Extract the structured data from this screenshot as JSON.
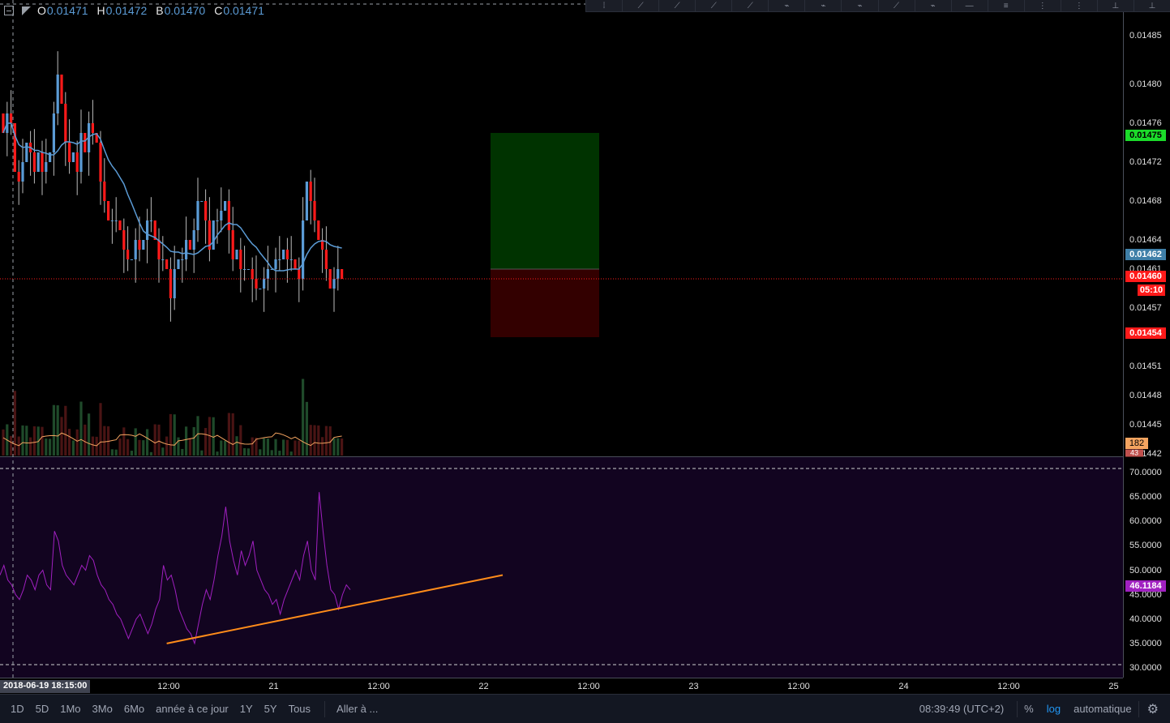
{
  "ohlc": {
    "o_label": "O",
    "o_value": "0.01471",
    "h_label": "H",
    "h_value": "0.01472",
    "b_label": "B",
    "b_value": "0.01470",
    "c_label": "C",
    "c_value": "0.01471"
  },
  "price_axis": {
    "labels": [
      "0.01485",
      "0.01480",
      "0.01476",
      "0.01472",
      "0.01468",
      "0.01464",
      "0.01461",
      "0.01457",
      "0.01451",
      "0.01448",
      "0.01445",
      "0.01442"
    ],
    "tags": {
      "take_profit": "0.01475",
      "ma": "0.01462",
      "last_price": "0.01460",
      "countdown": "05:10",
      "stop_loss": "0.01454",
      "volume_ma": "182",
      "volume": "43"
    }
  },
  "rsi_axis": {
    "labels": [
      "70.0000",
      "65.0000",
      "60.0000",
      "55.0000",
      "50.0000",
      "45.0000",
      "40.0000",
      "35.0000",
      "30.0000"
    ],
    "tag": "46.1184"
  },
  "time_axis": {
    "cursor": "2018-06-19 18:15:00",
    "labels": [
      "12:00",
      "21",
      "12:00",
      "22",
      "12:00",
      "23",
      "12:00",
      "24",
      "12:00",
      "25"
    ]
  },
  "bottom_bar": {
    "ranges": [
      "1D",
      "5D",
      "1Mo",
      "3Mo",
      "6Mo",
      "année à ce jour",
      "1Y",
      "5Y",
      "Tous"
    ],
    "goto": "Aller à ...",
    "clock": "08:39:49 (UTC+2)",
    "percent": "%",
    "log": "log",
    "auto": "automatique"
  },
  "colors": {
    "up": "#5b9bd5",
    "down": "#ff1a1a",
    "ma": "#5b9bd5",
    "rsi": "#a020c0",
    "rsi_bg": "#120420",
    "trendline": "#ff8c1a",
    "tp_zone": "#003300",
    "sl_zone": "#330000"
  },
  "chart_data": {
    "type": "candlestick",
    "price_range": [
      0.01442,
      0.01487
    ],
    "last_price": 0.0146,
    "candles_close": [
      0.01475,
      0.01477,
      0.01476,
      0.01471,
      0.0147,
      0.01472,
      0.01474,
      0.01473,
      0.01471,
      0.01473,
      0.01471,
      0.01472,
      0.01473,
      0.01477,
      0.01481,
      0.01478,
      0.01474,
      0.01472,
      0.01473,
      0.01471,
      0.01475,
      0.01473,
      0.01476,
      0.01475,
      0.01474,
      0.0147,
      0.01468,
      0.01466,
      0.01466,
      0.01466,
      0.01465,
      0.01463,
      0.01462,
      0.01462,
      0.01464,
      0.01463,
      0.01464,
      0.01466,
      0.01466,
      0.01464,
      0.01462,
      0.01462,
      0.01461,
      0.01458,
      0.01461,
      0.01462,
      0.01462,
      0.01464,
      0.01463,
      0.01465,
      0.01468,
      0.01468,
      0.01466,
      0.01463,
      0.01466,
      0.01466,
      0.01467,
      0.01468,
      0.01465,
      0.01462,
      0.01463,
      0.01461,
      0.01461,
      0.01461,
      0.0146,
      0.01459,
      0.01459,
      0.0146,
      0.01461,
      0.01461,
      0.01462,
      0.01462,
      0.01463,
      0.01462,
      0.01462,
      0.01461,
      0.0146,
      0.01466,
      0.0147,
      0.01468,
      0.01466,
      0.01464,
      0.01463,
      0.01461,
      0.01459,
      0.0146,
      0.01461,
      0.0146
    ],
    "volume_range": [
      0,
      300
    ],
    "volume_last": 43,
    "volume_ma_last": 182,
    "position": {
      "entry": 0.01461,
      "take_profit": 0.01475,
      "stop_loss": 0.01454
    },
    "rsi": {
      "range": [
        28,
        73
      ],
      "levels": [
        70,
        30
      ],
      "last": 46.1184,
      "values": [
        49,
        51,
        48,
        47,
        45,
        44,
        46,
        49,
        48,
        46,
        49,
        50,
        47,
        46,
        58,
        56,
        51,
        49,
        48,
        47,
        49,
        51,
        50,
        53,
        52,
        49,
        47,
        46,
        44,
        43,
        41,
        40,
        38,
        36,
        38,
        40,
        41,
        39,
        37,
        39,
        42,
        44,
        51,
        48,
        49,
        46,
        42,
        40,
        38,
        37,
        35,
        39,
        43,
        46,
        44,
        48,
        53,
        57,
        63,
        56,
        52,
        49,
        54,
        51,
        53,
        56,
        50,
        48,
        46,
        45,
        43,
        44,
        41,
        44,
        46,
        48,
        50,
        48,
        53,
        56,
        50,
        48,
        66,
        58,
        51,
        46,
        45,
        42,
        45,
        47,
        46
      ]
    },
    "trendline_rsi": [
      [
        12,
        35
      ],
      [
        74,
        49
      ]
    ]
  }
}
